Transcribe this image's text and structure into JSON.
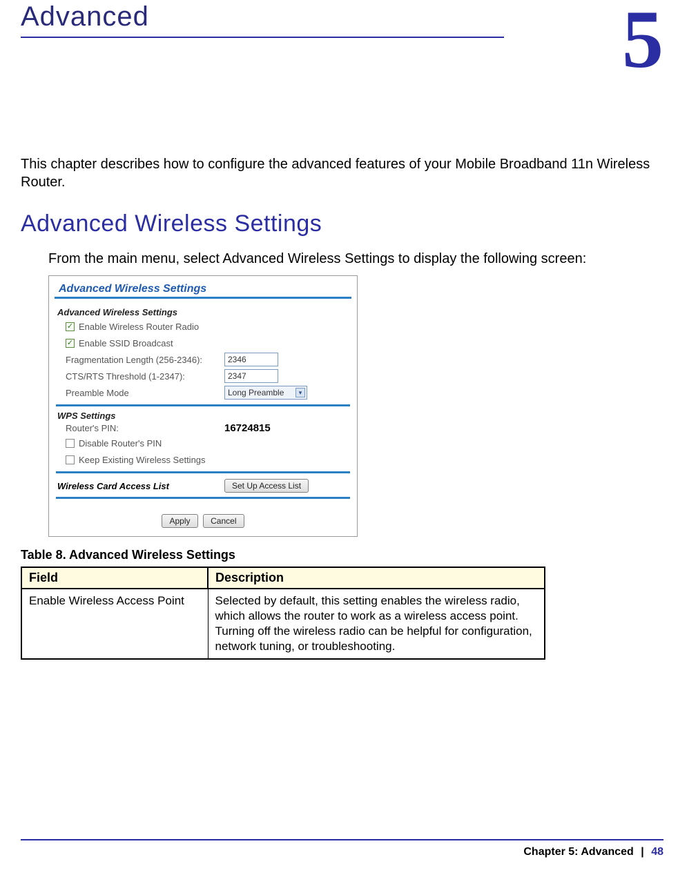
{
  "header": {
    "chapter_title": "Advanced",
    "chapter_number": "5"
  },
  "intro": {
    "text": "This chapter describes how to configure the advanced features of your Mobile Broadband 11n Wireless Router."
  },
  "section": {
    "title": "Advanced Wireless Settings",
    "instruction": "From the main menu, select Advanced Wireless Settings to display the following screen:"
  },
  "screenshot": {
    "title": "Advanced Wireless Settings",
    "group1_label": "Advanced Wireless Settings",
    "enable_radio_label": "Enable Wireless Router Radio",
    "enable_ssid_label": "Enable SSID Broadcast",
    "frag_label": "Fragmentation Length (256-2346):",
    "frag_value": "2346",
    "cts_label": "CTS/RTS Threshold (1-2347):",
    "cts_value": "2347",
    "preamble_label": "Preamble Mode",
    "preamble_value": "Long Preamble",
    "wps_label": "WPS Settings",
    "pin_label": "Router's PIN:",
    "pin_value": "16724815",
    "disable_pin_label": "Disable Router's PIN",
    "keep_settings_label": "Keep Existing Wireless Settings",
    "acl_label": "Wireless Card Access List",
    "acl_button": "Set Up Access List",
    "apply_button": "Apply",
    "cancel_button": "Cancel"
  },
  "table": {
    "caption": "Table 8.  Advanced Wireless Settings",
    "headers": {
      "field": "Field",
      "description": "Description"
    },
    "rows": [
      {
        "field": "Enable Wireless Access Point",
        "description": "Selected by default, this setting enables the wireless radio, which allows the router to work as a wireless access point.\nTurning off the wireless radio can be helpful for configuration, network tuning, or troubleshooting."
      }
    ]
  },
  "footer": {
    "chapter_label": "Chapter 5:  Advanced",
    "separator": "|",
    "page_number": "48"
  }
}
